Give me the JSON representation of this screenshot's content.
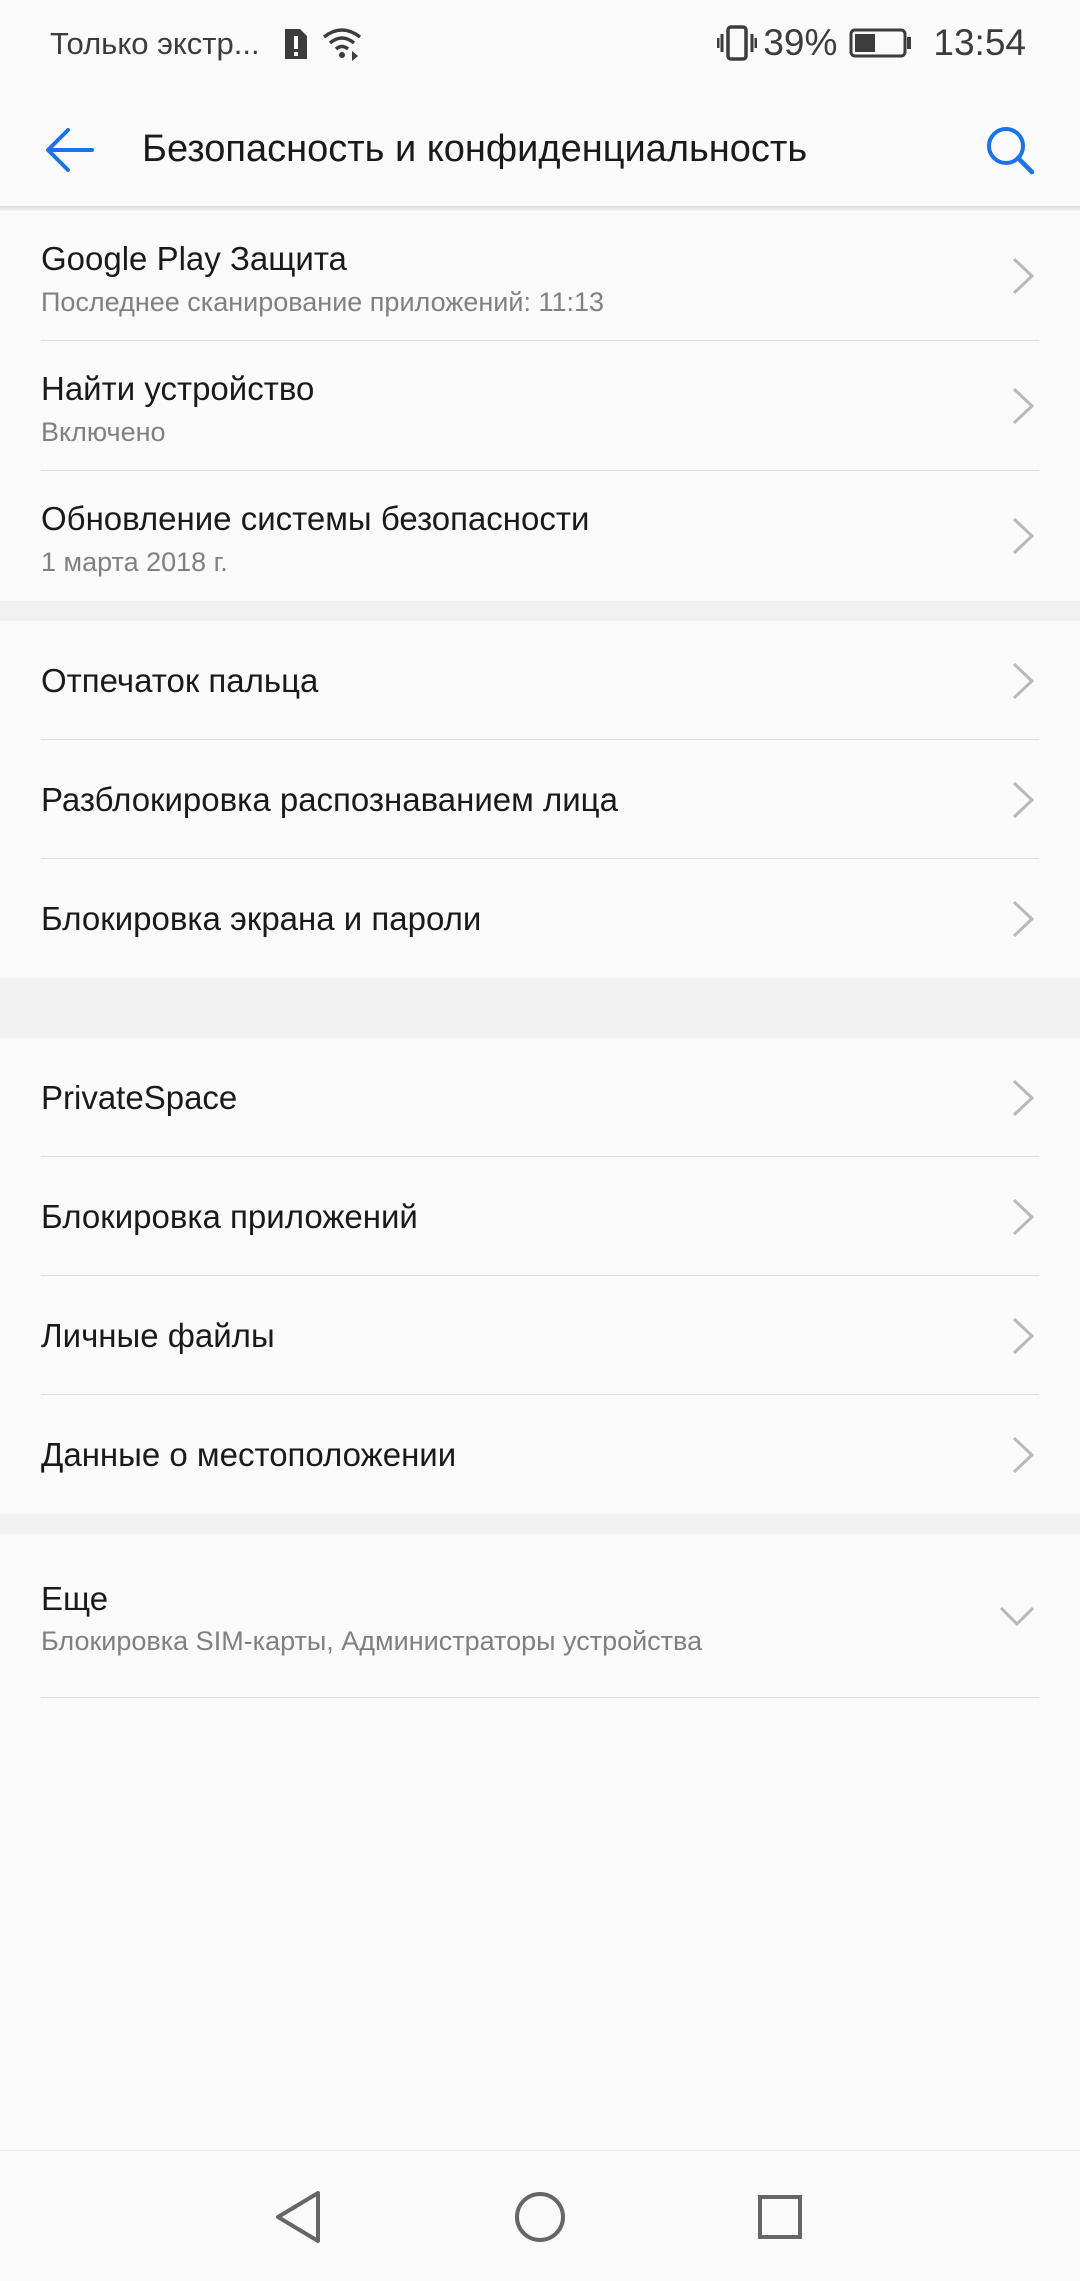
{
  "status_bar": {
    "notice": "Только экстр...",
    "battery_percent": "39%",
    "time": "13:54"
  },
  "app_bar": {
    "title": "Безопасность и конфиденциальность"
  },
  "groups": [
    {
      "items": [
        {
          "title": "Google Play Защита",
          "subtitle": "Последнее сканирование приложений: 11:13"
        },
        {
          "title": "Найти устройство",
          "subtitle": "Включено"
        },
        {
          "title": "Обновление системы безопасности",
          "subtitle": "1 марта 2018 г."
        }
      ]
    },
    {
      "items": [
        {
          "title": "Отпечаток пальца"
        },
        {
          "title": "Разблокировка распознаванием лица"
        },
        {
          "title": "Блокировка экрана и пароли"
        }
      ]
    },
    {
      "items": [
        {
          "title": "PrivateSpace"
        },
        {
          "title": "Блокировка приложений"
        },
        {
          "title": "Личные файлы"
        },
        {
          "title": "Данные о местоположении"
        }
      ]
    },
    {
      "items": [
        {
          "title": "Еще",
          "subtitle": "Блокировка SIM-карты, Администраторы устройства"
        }
      ]
    }
  ],
  "colors": {
    "accent": "#1a73e8",
    "background": "#fafafa",
    "gap": "#f1f1f1",
    "chevron": "#b8b8b8"
  }
}
